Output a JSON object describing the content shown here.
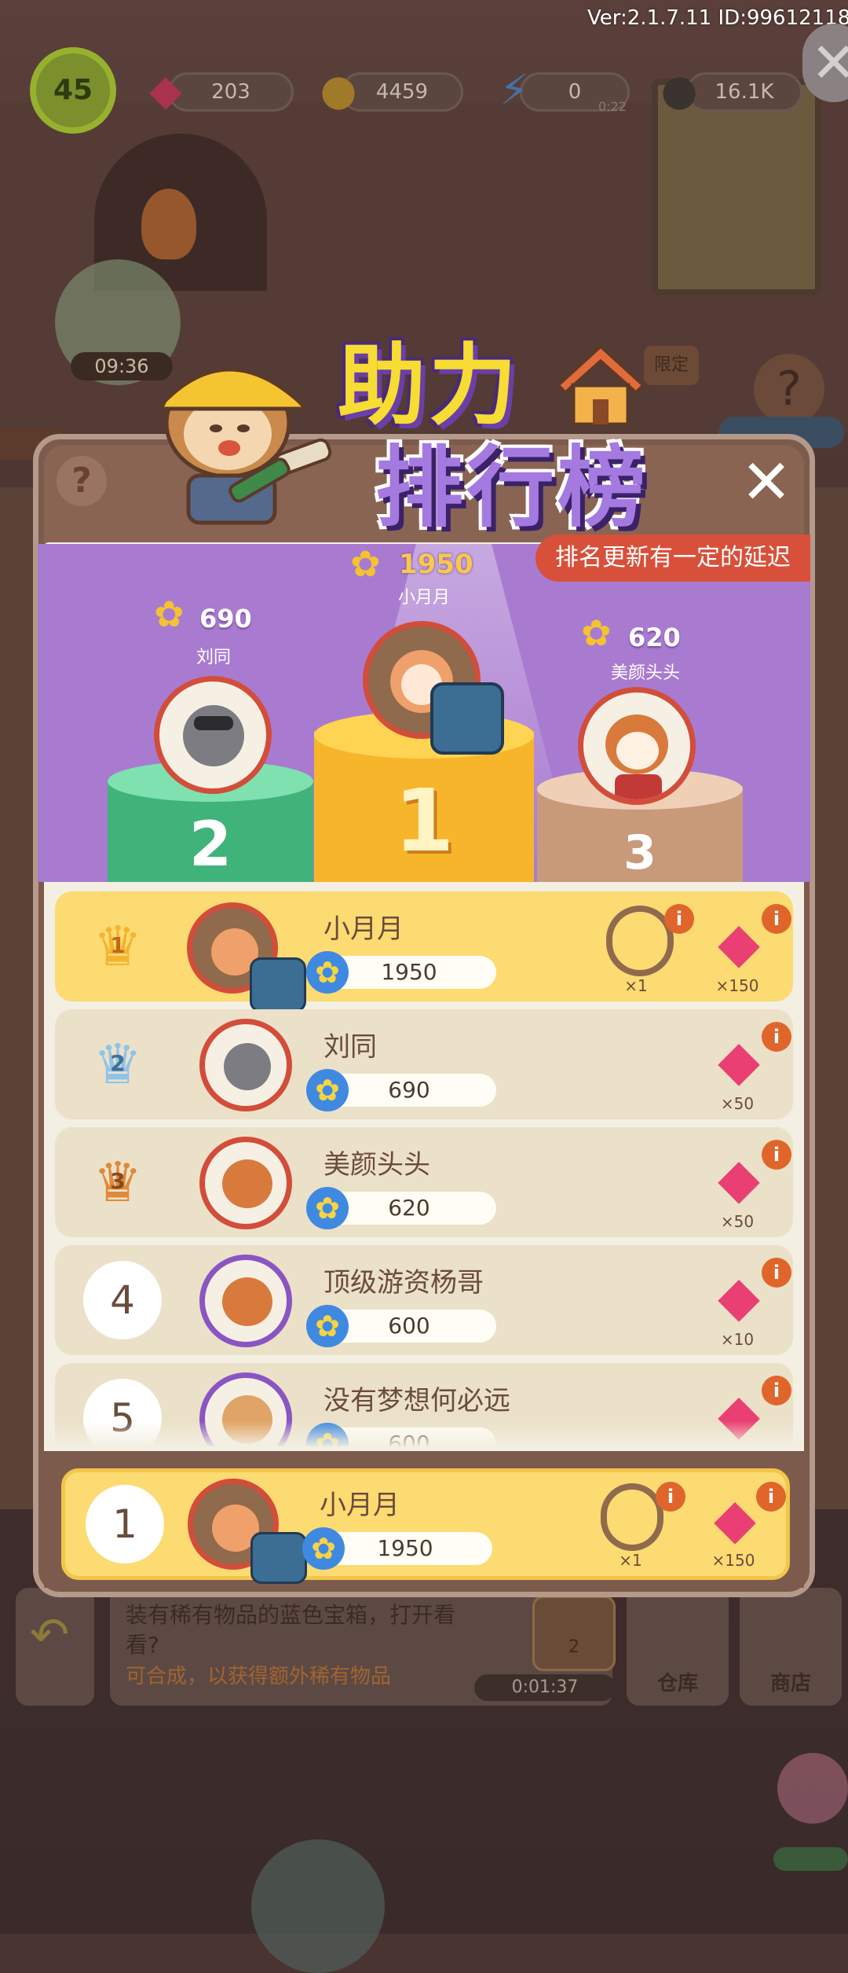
{
  "top_bar": {
    "version": "Ver:2.1.7.11  ID:99612118",
    "level": "45",
    "gems": "203",
    "coins": "4459",
    "energy": "0",
    "energy_timer": "0:22",
    "seeds": "16.1K"
  },
  "background": {
    "bubble_timer": "09:36",
    "limited_label": "限定",
    "task_text": "装有稀有物品的蓝色宝箱，打开看看?",
    "task_hint": "可合成，以获得额外稀有物品",
    "task_timer": "0:01:37",
    "warehouse_label": "仓库",
    "shop_label": "商店",
    "gem_slot_count": "2"
  },
  "panel": {
    "title_line1": "助力",
    "title_line2": "排行榜",
    "notice": "排名更新有一定的延迟"
  },
  "podium": {
    "first": {
      "name": "小月月",
      "score": "1950",
      "place": "1"
    },
    "second": {
      "name": "刘同",
      "score": "690",
      "place": "2"
    },
    "third": {
      "name": "美颜头头",
      "score": "620",
      "place": "3"
    }
  },
  "rows": [
    {
      "rank": "1",
      "name": "小月月",
      "score": "1950",
      "reward_item_count": "×1",
      "reward_gem_count": "×150"
    },
    {
      "rank": "2",
      "name": "刘同",
      "score": "690",
      "reward_gem_count": "×50"
    },
    {
      "rank": "3",
      "name": "美颜头头",
      "score": "620",
      "reward_gem_count": "×50"
    },
    {
      "rank": "4",
      "name": "顶级游资杨哥",
      "score": "600",
      "reward_gem_count": "×10"
    },
    {
      "rank": "5",
      "name": "没有梦想何必远",
      "score": "600",
      "reward_gem_count": ""
    }
  ],
  "my_row": {
    "rank": "1",
    "name": "小月月",
    "score": "1950",
    "reward_item_count": "×1",
    "reward_gem_count": "×150"
  },
  "icons": {
    "gem": "gem-icon",
    "coin": "coin-icon",
    "energy": "lightning-icon",
    "seed": "sunflower-seed-icon",
    "flower": "flower-icon",
    "crown": "crown-icon",
    "info": "info-icon"
  },
  "colors": {
    "stage_purple": "#a97bd0",
    "gold_row": "#fbdb72",
    "notice_red": "#d8503a",
    "gem_pink": "#ea3f72"
  }
}
